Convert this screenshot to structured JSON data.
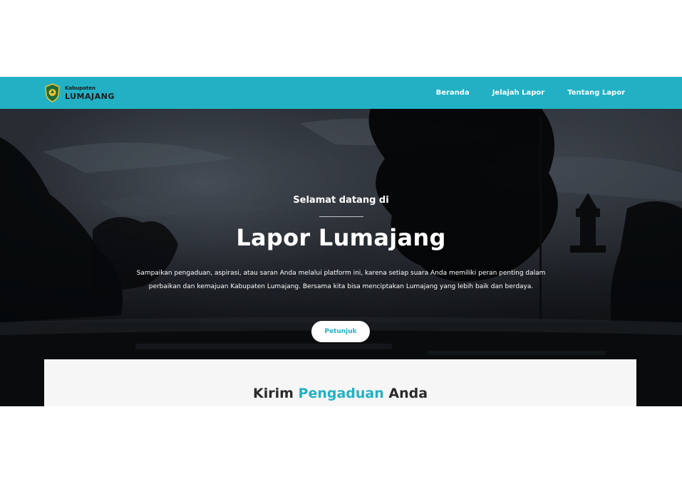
{
  "navbar": {
    "brand_small": "Kabupaten",
    "brand_big": "LUMAJANG",
    "links": [
      "Beranda",
      "Jelajah Lapor",
      "Tentang Lapor"
    ],
    "color": "#22b1c4"
  },
  "hero": {
    "welcome": "Selamat datang di",
    "title": "Lapor Lumajang",
    "description": "Sampaikan pengaduan, aspirasi, atau saran Anda melalui platform ini, karena setiap suara Anda memiliki peran penting dalam perbaikan dan kemajuan Kabupaten Lumajang. Bersama kita bisa menciptakan Lumajang yang lebih baik dan berdaya.",
    "button_label": "Petunjuk"
  },
  "card": {
    "title_part1": "Kirim",
    "title_accent": "Pengaduan",
    "title_part2": "Anda"
  },
  "icons": {
    "logo": "lumajang-crest-icon"
  }
}
